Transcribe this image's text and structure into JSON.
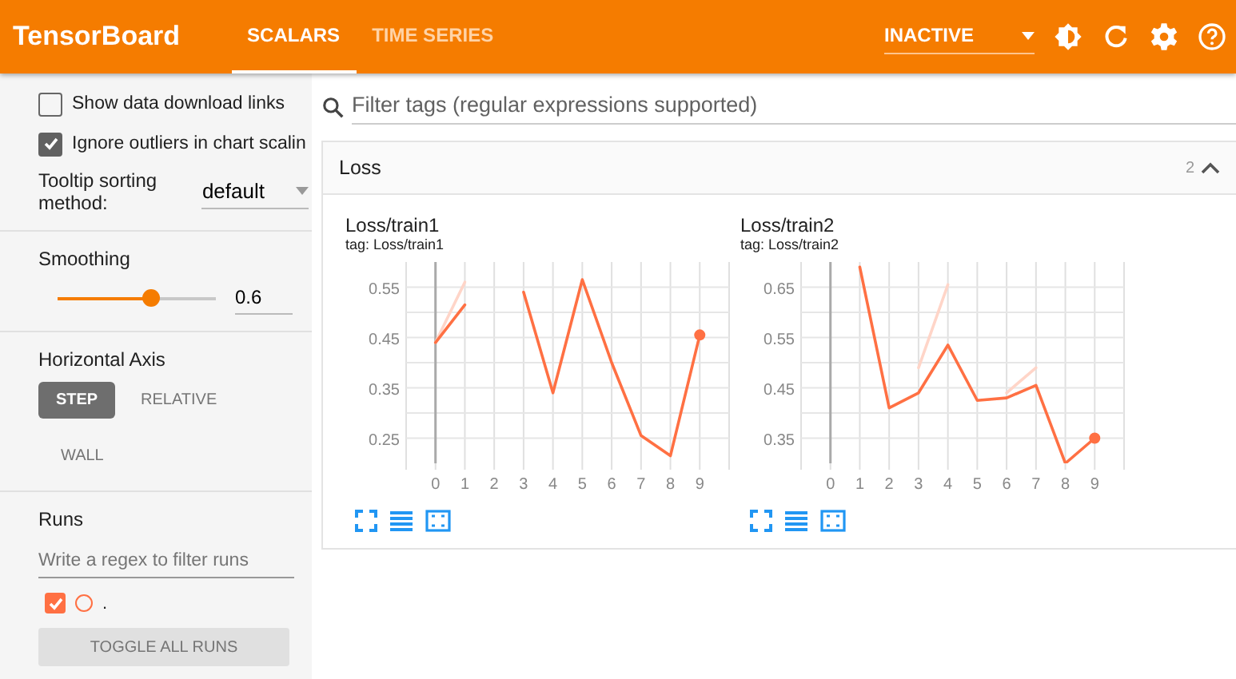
{
  "header": {
    "title": "TensorBoard",
    "tabs": [
      {
        "label": "SCALARS",
        "selected": true
      },
      {
        "label": "TIME SERIES",
        "selected": false
      }
    ],
    "run_status": "INACTIVE"
  },
  "sidebar": {
    "options": [
      {
        "label": "Show data download links",
        "checked": false
      },
      {
        "label": "Ignore outliers in chart scalin",
        "checked": true
      }
    ],
    "tooltip_sorting": {
      "label": "Tooltip sorting method:",
      "value": "default"
    },
    "smoothing": {
      "label": "Smoothing",
      "level": 0.6,
      "value": "0.6"
    },
    "horizontal_axis": {
      "label": "Horizontal Axis",
      "options": [
        {
          "label": "STEP",
          "selected": true
        },
        {
          "label": "RELATIVE",
          "selected": false
        },
        {
          "label": "WALL",
          "selected": false
        }
      ]
    },
    "runs": {
      "label": "Runs",
      "filter_placeholder": "Write a regex to filter runs",
      "items": [
        {
          "name": ".",
          "checked": true,
          "color": "#ff7043"
        }
      ],
      "toggle_button": "TOGGLE ALL RUNS"
    }
  },
  "main": {
    "search": {
      "placeholder": "Filter tags (regular expressions supported)"
    },
    "group": {
      "title": "Loss",
      "count": "2",
      "expanded": true,
      "cards": [
        {
          "title": "Loss/train1",
          "tag": "tag: Loss/train1",
          "chart_data": {
            "type": "line",
            "x": [
              0,
              1,
              2,
              3,
              4,
              5,
              6,
              7,
              8,
              9
            ],
            "grid": true,
            "xlim": [
              -1,
              10
            ],
            "ylim": [
              0.2,
              0.6
            ],
            "xticks": [
              0,
              1,
              2,
              3,
              4,
              5,
              6,
              7,
              8,
              9
            ],
            "yticks": [
              0.25,
              0.35,
              0.45,
              0.55
            ],
            "series": [
              {
                "color": "#ffd5c8",
                "values": [
                  0.44,
                  0.56,
                  null,
                  null,
                  null,
                  null,
                  null,
                  null,
                  null,
                  null
                ]
              },
              {
                "color": "#ff7043",
                "values": [
                  0.44,
                  0.515,
                  null,
                  0.54,
                  0.34,
                  0.565,
                  0.4,
                  0.255,
                  0.215,
                  0.455
                ]
              }
            ]
          }
        },
        {
          "title": "Loss/train2",
          "tag": "tag: Loss/train2",
          "chart_data": {
            "type": "line",
            "x": [
              1,
              2,
              3,
              4,
              5,
              6,
              7,
              8,
              9
            ],
            "grid": true,
            "xlim": [
              -1,
              10
            ],
            "ylim": [
              0.3,
              0.7
            ],
            "xticks": [
              0,
              1,
              2,
              3,
              4,
              5,
              6,
              7,
              8,
              9
            ],
            "yticks": [
              0.35,
              0.45,
              0.55,
              0.65
            ],
            "series": [
              {
                "color": "#ffd5c8",
                "values": [
                  null,
                  null,
                  0.49,
                  0.655,
                  null,
                  0.44,
                  0.49,
                  null,
                  null
                ]
              },
              {
                "color": "#ff7043",
                "values": [
                  0.69,
                  0.41,
                  0.44,
                  0.535,
                  0.425,
                  0.43,
                  0.455,
                  0.3,
                  0.35
                ]
              }
            ]
          }
        }
      ]
    }
  }
}
